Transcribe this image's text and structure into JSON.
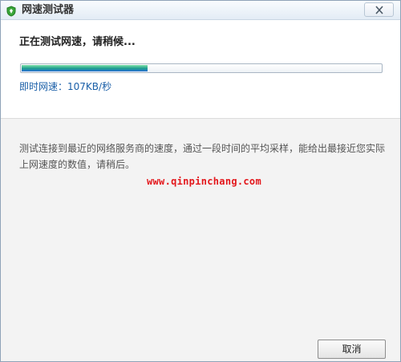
{
  "window": {
    "title": "网速测试器",
    "close_symbol": "X"
  },
  "status": {
    "text": "正在测试网速，请稍候..."
  },
  "progress": {
    "fraction": 0.35
  },
  "speed": {
    "label": "即时网速：",
    "value": "107KB/秒"
  },
  "description": {
    "text": "测试连接到最近的网络服务商的速度，通过一段时间的平均采样，能给出最接近您实际上网速度的数值，请稍后。"
  },
  "watermark": {
    "text": "www.qinpinchang.com"
  },
  "buttons": {
    "cancel_label": "取消"
  },
  "icons": {
    "app": "shield-app-icon",
    "close": "close-icon"
  },
  "colors": {
    "title_bar": "#e3ecf5",
    "speed_text": "#1a5fa8",
    "progress_fill": "#1b9b8e",
    "watermark": "#e3161b"
  }
}
